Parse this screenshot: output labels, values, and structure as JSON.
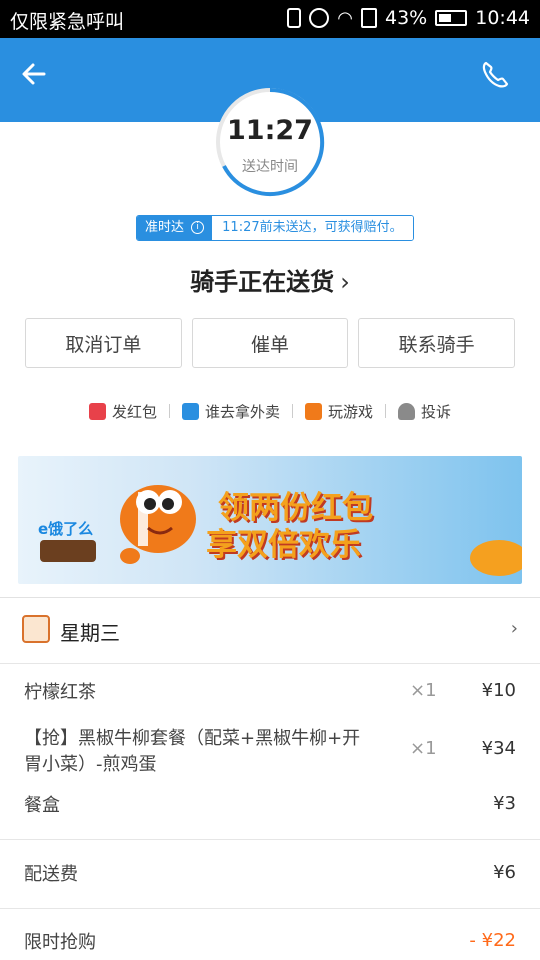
{
  "status_bar": {
    "carrier_text": "仅限紧急呼叫",
    "battery": "43%",
    "time": "10:44"
  },
  "topbar": {
    "back_icon": "back-arrow-icon",
    "phone_icon": "phone-icon",
    "color": "#2a8fe0"
  },
  "delivery": {
    "eta_time": "11:27",
    "eta_label": "送达时间",
    "ontime_badge": "准时达",
    "ontime_message": "11:27前未送达，可获得赔付。",
    "status_title": "骑手正在送货",
    "status_chevron": "›"
  },
  "actions": [
    {
      "label": "取消订单"
    },
    {
      "label": "催单"
    },
    {
      "label": "联系骑手"
    }
  ],
  "quick_links": [
    {
      "label": "发红包",
      "icon": "red-envelope-icon"
    },
    {
      "label": "谁去拿外卖",
      "icon": "dice-icon"
    },
    {
      "label": "玩游戏",
      "icon": "gamepad-icon"
    },
    {
      "label": "投诉",
      "icon": "complaint-icon"
    }
  ],
  "banner": {
    "brand": "e饿了么",
    "headline_line1": "领两份红包",
    "headline_line2": "享双倍欢乐"
  },
  "shop": {
    "name": "星期三",
    "chevron": "›"
  },
  "order_items": [
    {
      "name": "柠檬红茶",
      "qty": "×1",
      "price": "¥10"
    },
    {
      "name_line1": "【抢】黑椒牛柳套餐（配菜+黑椒牛柳+开",
      "name_line2": "胃小菜）-煎鸡蛋",
      "qty": "×1",
      "price": "¥34"
    },
    {
      "name": "餐盒",
      "price": "¥3"
    }
  ],
  "fees": {
    "delivery_label": "配送费",
    "delivery_price": "¥6",
    "flash_label": "限时抢购",
    "flash_price": "- ¥22"
  }
}
